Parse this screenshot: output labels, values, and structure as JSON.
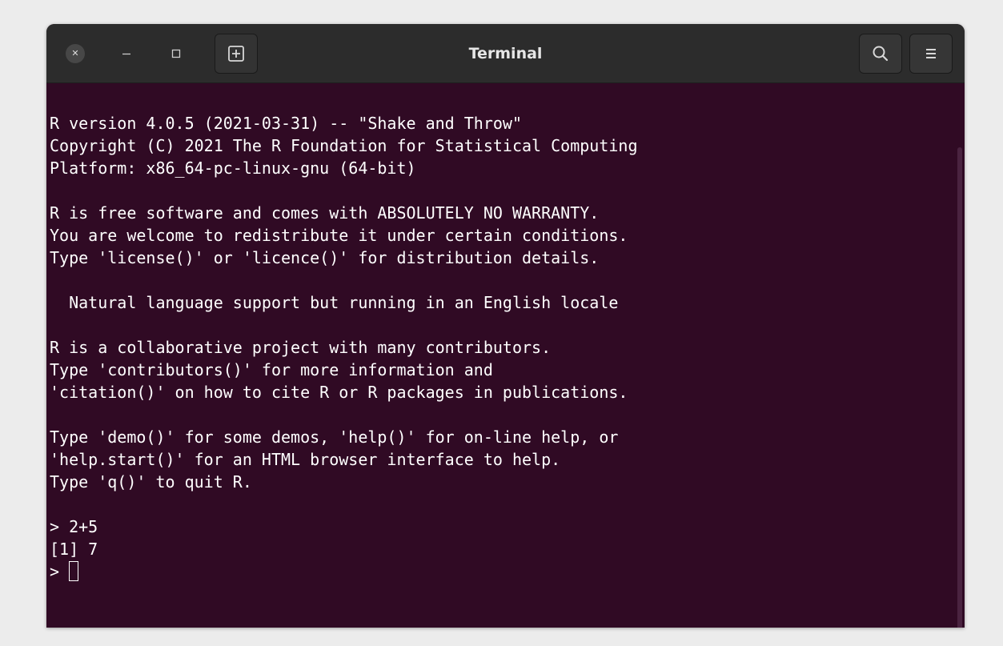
{
  "window": {
    "title": "Terminal"
  },
  "titlebar": {
    "close_icon": "close-icon",
    "minimize_icon": "minimize-icon",
    "maximize_icon": "maximize-icon",
    "new_tab_icon": "new-tab-icon",
    "search_icon": "search-icon",
    "menu_icon": "hamburger-menu-icon"
  },
  "colors": {
    "terminal_background": "#300a24",
    "terminal_foreground": "#ffffff",
    "titlebar_background": "#2c2c2c"
  },
  "terminal": {
    "lines": [
      "R version 4.0.5 (2021-03-31) -- \"Shake and Throw\"",
      "Copyright (C) 2021 The R Foundation for Statistical Computing",
      "Platform: x86_64-pc-linux-gnu (64-bit)",
      "",
      "R is free software and comes with ABSOLUTELY NO WARRANTY.",
      "You are welcome to redistribute it under certain conditions.",
      "Type 'license()' or 'licence()' for distribution details.",
      "",
      "  Natural language support but running in an English locale",
      "",
      "R is a collaborative project with many contributors.",
      "Type 'contributors()' for more information and",
      "'citation()' on how to cite R or R packages in publications.",
      "",
      "Type 'demo()' for some demos, 'help()' for on-line help, or",
      "'help.start()' for an HTML browser interface to help.",
      "Type 'q()' to quit R.",
      "",
      "> 2+5",
      "[1] 7"
    ],
    "prompt": "> "
  }
}
